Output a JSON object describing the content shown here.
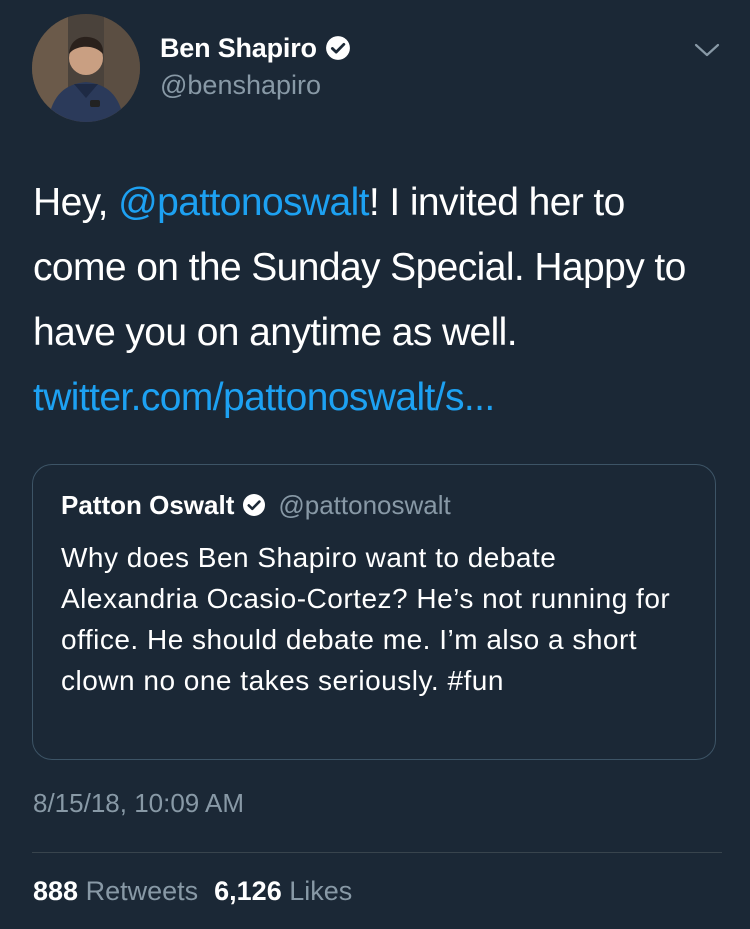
{
  "author": {
    "display_name": "Ben Shapiro",
    "handle": "@benshapiro",
    "verified": true
  },
  "tweet": {
    "text_before_mention": "Hey, ",
    "mention": "@pattonoswalt",
    "text_after_mention": "! I invited her to come on the Sunday Special. Happy to have you on anytime as well.",
    "link": "twitter.com/pattonoswalt/s..."
  },
  "quoted_tweet": {
    "display_name": "Patton Oswalt",
    "handle": "@pattonoswalt",
    "verified": true,
    "text": "Why does Ben Shapiro want to debate Alexandria Ocasio-Cortez? He’s not running for office. He should debate me. I’m also a short clown no one takes seriously. #fun"
  },
  "timestamp": "8/15/18, 10:09 AM",
  "stats": {
    "retweets_count": "888",
    "retweets_label": "Retweets",
    "likes_count": "6,126",
    "likes_label": "Likes"
  },
  "icons": {
    "verified": "verified-badge-icon",
    "menu": "chevron-down-icon"
  },
  "colors": {
    "background": "#1b2836",
    "link": "#1da1f2",
    "secondary_text": "#8899a6",
    "border": "#3d5466"
  }
}
